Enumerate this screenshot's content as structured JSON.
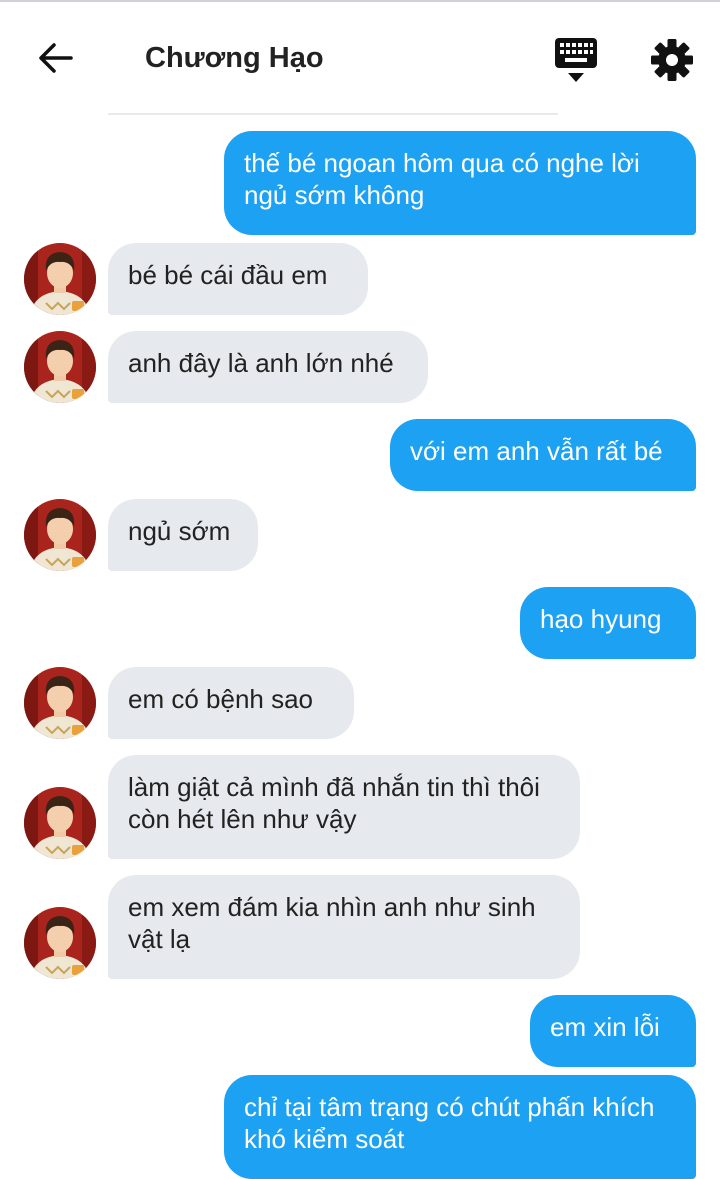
{
  "header": {
    "title": "Chương Hạo"
  },
  "icons": {
    "back": "arrow-left-icon",
    "keyboard": "keyboard-icon",
    "settings": "gear-icon"
  },
  "colors": {
    "outgoing_bubble": "#1da1f2",
    "incoming_bubble": "#e6e9ed",
    "text": "#222222"
  },
  "messages": [
    {
      "side": "out",
      "text": "thế bé ngoan hôm qua có nghe lời ngủ sớm không"
    },
    {
      "side": "in",
      "text": "bé bé cái đầu em"
    },
    {
      "side": "in",
      "text": "anh đây là anh lớn nhé"
    },
    {
      "side": "out",
      "text": "với em anh vẫn rất bé"
    },
    {
      "side": "in",
      "text": "ngủ sớm"
    },
    {
      "side": "out",
      "text": "hạo hyung"
    },
    {
      "side": "in",
      "text": "em có bệnh sao"
    },
    {
      "side": "in",
      "text": "làm giật cả mình đã nhắn tin thì thôi còn hét lên như vậy"
    },
    {
      "side": "in",
      "text": "em xem đám kia nhìn anh như sinh vật lạ"
    },
    {
      "side": "out",
      "text": "em xin lỗi"
    },
    {
      "side": "out",
      "text": "chỉ tại tâm trạng có chút phấn khích khó kiểm soát"
    }
  ]
}
